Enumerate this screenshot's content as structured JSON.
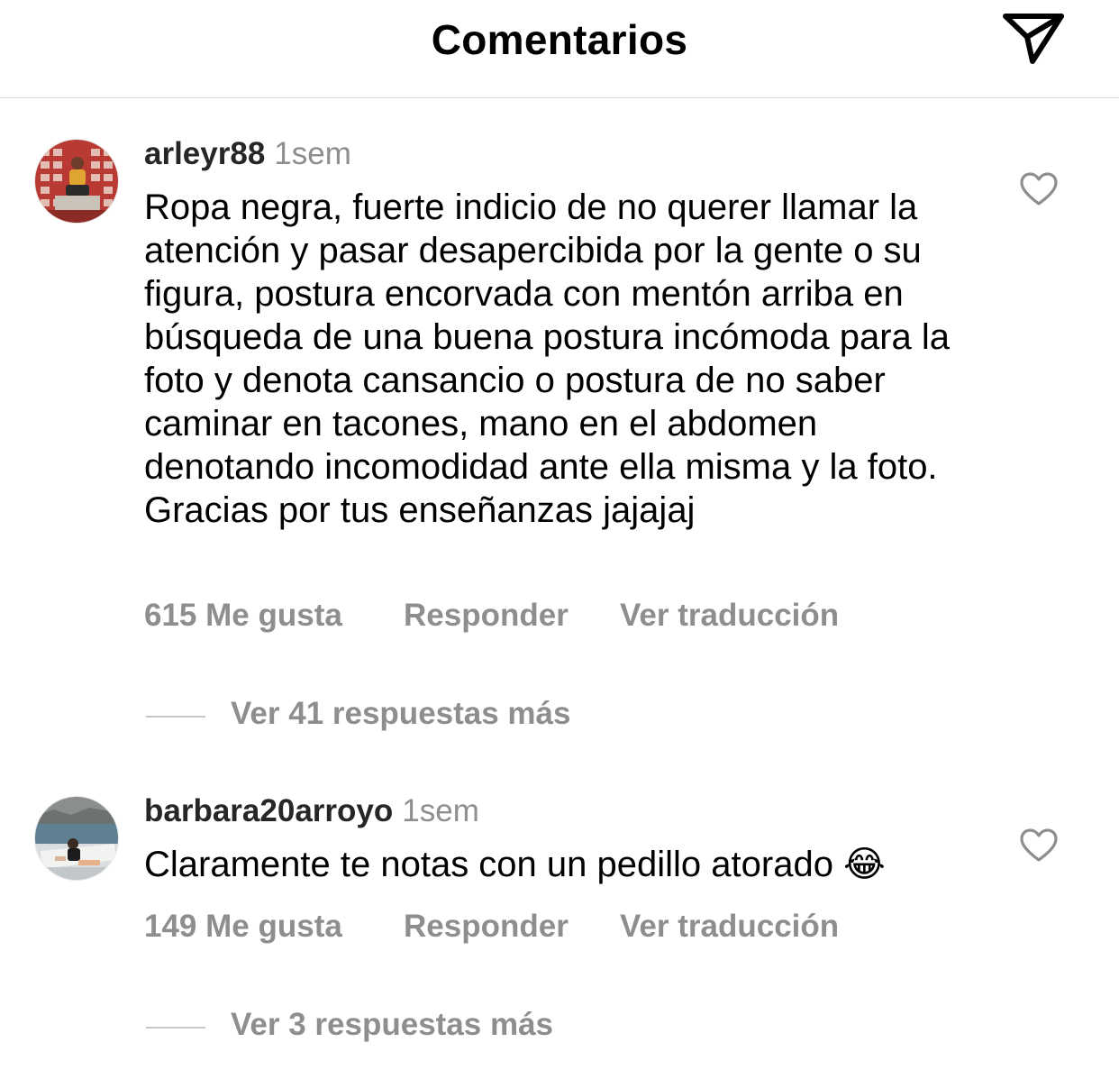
{
  "header": {
    "title": "Comentarios"
  },
  "comments": [
    {
      "username": "arleyr88",
      "time": "1sem",
      "text": "Ropa negra, fuerte indicio de no querer llamar la atención y pasar desapercibida por la gente o su figura, postura encorvada con mentón arriba en búsqueda de una buena postura incómoda para la foto y denota cansancio o postura de no saber caminar en tacones, mano en el abdomen denotando incomodidad ante ella misma y la foto. Gracias por tus enseñanzas jajajaj",
      "likes_label": "615 Me gusta",
      "reply_label": "Responder",
      "translate_label": "Ver traducción",
      "more_replies_label": "Ver 41 respuestas más"
    },
    {
      "username": "barbara20arroyo",
      "time": "1sem",
      "text": "Claramente te notas con un pedillo atorado 😂",
      "likes_label": "149 Me gusta",
      "reply_label": "Responder",
      "translate_label": "Ver traducción",
      "more_replies_label": "Ver 3 respuestas más"
    }
  ],
  "icons": {
    "share": "send-icon",
    "like": "heart-icon"
  },
  "colors": {
    "secondary_text": "#8e8e8e",
    "primary_text": "#000000",
    "divider": "#dbdbdb"
  }
}
